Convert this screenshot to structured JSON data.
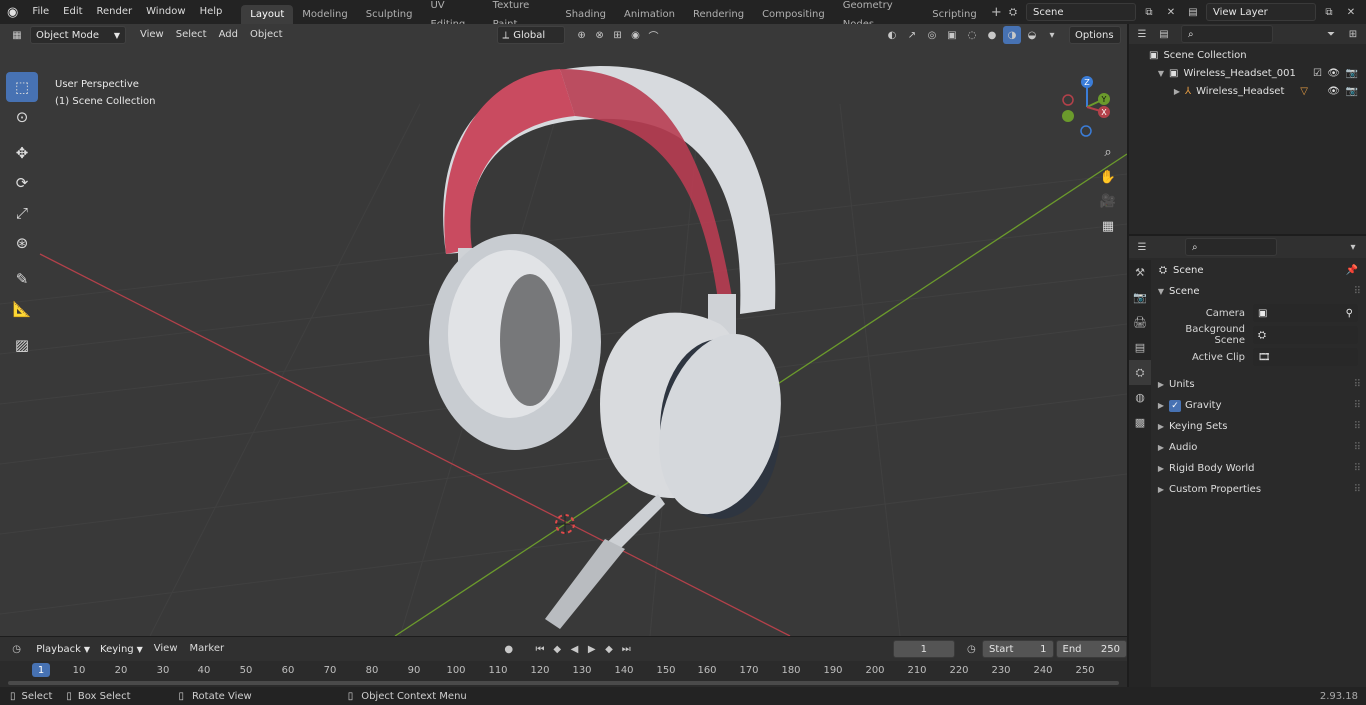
{
  "topbar": {
    "menus": [
      "File",
      "Edit",
      "Render",
      "Window",
      "Help"
    ],
    "workspaces": [
      "Layout",
      "Modeling",
      "Sculpting",
      "UV Editing",
      "Texture Paint",
      "Shading",
      "Animation",
      "Rendering",
      "Compositing",
      "Geometry Nodes",
      "Scripting"
    ],
    "active_workspace": "Layout",
    "scene_name": "Scene",
    "view_layer": "View Layer"
  },
  "viewport": {
    "mode": "Object Mode",
    "menus": [
      "View",
      "Select",
      "Add",
      "Object"
    ],
    "transform_orientation": "Global",
    "options_label": "Options",
    "info_line1": "User Perspective",
    "info_line2": "(1) Scene Collection",
    "gizmo_axes": [
      "Z",
      "Y",
      "X"
    ]
  },
  "timeline": {
    "menus": [
      "Playback",
      "Keying",
      "View",
      "Marker"
    ],
    "current_frame": "1",
    "start_label": "Start",
    "start_value": "1",
    "end_label": "End",
    "end_value": "250",
    "ticks": [
      "1",
      "10",
      "20",
      "30",
      "40",
      "50",
      "60",
      "70",
      "80",
      "90",
      "100",
      "110",
      "120",
      "130",
      "140",
      "150",
      "160",
      "170",
      "180",
      "190",
      "200",
      "210",
      "220",
      "230",
      "240",
      "250"
    ]
  },
  "status": {
    "select": "Select",
    "box_select": "Box Select",
    "rotate_view": "Rotate View",
    "context_menu": "Object Context Menu",
    "version": "2.93.18"
  },
  "outliner": {
    "root": "Scene Collection",
    "collection": "Wireless_Headset_001",
    "object": "Wireless_Headset"
  },
  "properties": {
    "context": "Scene",
    "panel": "Scene",
    "camera_label": "Camera",
    "bg_scene_label": "Background Scene",
    "active_clip_label": "Active Clip",
    "subpanels": [
      "Units",
      "Gravity",
      "Keying Sets",
      "Audio",
      "Rigid Body World",
      "Custom Properties"
    ]
  },
  "colors": {
    "accent": "#4772b3",
    "x_axis": "#b3414a",
    "y_axis": "#6b9a2c",
    "z_axis": "#3b7dd8"
  }
}
